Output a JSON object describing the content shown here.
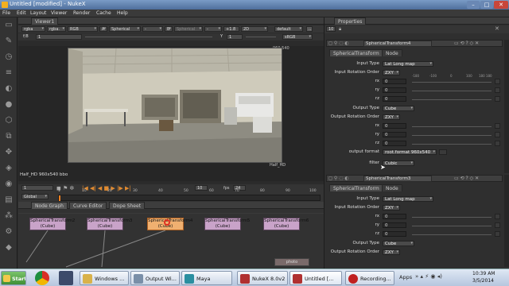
{
  "window": {
    "title": "Untitled [modified] - NukeX"
  },
  "menu": [
    "File",
    "Edit",
    "Layout",
    "Viewer",
    "Render",
    "Cache",
    "Help"
  ],
  "viewer": {
    "tab": "Viewer1",
    "controls": {
      "channels": "rgba",
      "channel_a": "rgba.",
      "colorspace": "RGB",
      "input_a": "A",
      "node_a": "Spherical",
      "dash": "-",
      "b": "B",
      "node_b": "Spherical",
      "dash2": "-",
      "gain": "+1.8",
      "view_mode": "2D",
      "lut": "default",
      "f_label": "f/8",
      "f_value": "1",
      "y_label": "Y",
      "y_value": "1",
      "display": "sRGB"
    },
    "resolution_label": "960,540",
    "format_label": "Half_HD",
    "info": "Half_HD 960x540 bbo",
    "frame": "1",
    "fps_label": "fps",
    "fps_value": "24",
    "step": "10",
    "global": "Global",
    "ruler": [
      "1",
      "10",
      "20",
      "30",
      "40",
      "50",
      "60",
      "70",
      "80",
      "90",
      "100"
    ]
  },
  "nodegraph": {
    "tabs": [
      "Node Graph",
      "Curve Editor",
      "Dope Sheet"
    ],
    "nodes": [
      {
        "name": "SphericalTransform2",
        "sub": "(Cube)",
        "selected": false
      },
      {
        "name": "SphericalTransform3",
        "sub": "(Cube)",
        "selected": false
      },
      {
        "name": "SphericalTransform4",
        "sub": "(Cube)",
        "selected": true
      },
      {
        "name": "SphericalTransform5",
        "sub": "(Cube)",
        "selected": false
      },
      {
        "name": "SphericalTransform6",
        "sub": "(Cube)",
        "selected": false
      }
    ],
    "bottom_node": "photo"
  },
  "properties": {
    "title": "Properties",
    "count": "10",
    "panel1": {
      "name": "SphericalTransform4",
      "tabs": [
        "SphericalTransform",
        "Node"
      ],
      "input_type_label": "Input Type",
      "input_type": "Lat Long map",
      "input_rot_label": "Input Rotation Order",
      "input_rot": "ZXY",
      "in_rows": [
        {
          "label": "rx",
          "value": "0"
        },
        {
          "label": "ry",
          "value": "0"
        },
        {
          "label": "rz",
          "value": "0"
        }
      ],
      "output_type_label": "Output Type",
      "output_type": "Cube",
      "output_rot_label": "Output Rotation Order",
      "output_rot": "ZXY",
      "out_rows": [
        {
          "label": "rx",
          "value": "0"
        },
        {
          "label": "ry",
          "value": "0"
        },
        {
          "label": "rz",
          "value": "0"
        }
      ],
      "format_label": "output format",
      "format": "root.format 960x540",
      "filter_label": "filter",
      "filter": "Cubic"
    },
    "panel2": {
      "name": "SphericalTransform3",
      "tabs": [
        "SphericalTransform",
        "Node"
      ],
      "input_type_label": "Input Type",
      "input_type": "Lat Long map",
      "input_rot_label": "Input Rotation Order",
      "input_rot": "ZXY",
      "in_rows": [
        {
          "label": "rx",
          "value": "0"
        },
        {
          "label": "ry",
          "value": "0"
        },
        {
          "label": "rz",
          "value": "0"
        }
      ],
      "output_type_label": "Output Type",
      "output_type": "Cube",
      "output_rot_label": "Output Rotation Order",
      "output_rot": "ZXY"
    },
    "slider_ticks": [
      "-180",
      "-100",
      "0",
      "100",
      "180 180"
    ]
  },
  "taskbar": {
    "start": "Start",
    "tasks": [
      {
        "label": "Windows ...",
        "color": "#d9b24a"
      },
      {
        "label": "Output Wi...",
        "color": "#7a8fa8"
      },
      {
        "label": "Maya",
        "color": "#2a8fa0"
      },
      {
        "label": "NukeX 8.0v2",
        "color": "#b03030"
      },
      {
        "label": "Untitled [...",
        "color": "#b03030"
      },
      {
        "label": "Recording...",
        "color": "#c02020"
      }
    ],
    "apps_label": "Apps",
    "time": "10:39 AM",
    "date": "3/5/2014"
  },
  "colors": {
    "selected_node": "#f0b070",
    "node": "#c9a3c9",
    "accent": "#f08020"
  }
}
